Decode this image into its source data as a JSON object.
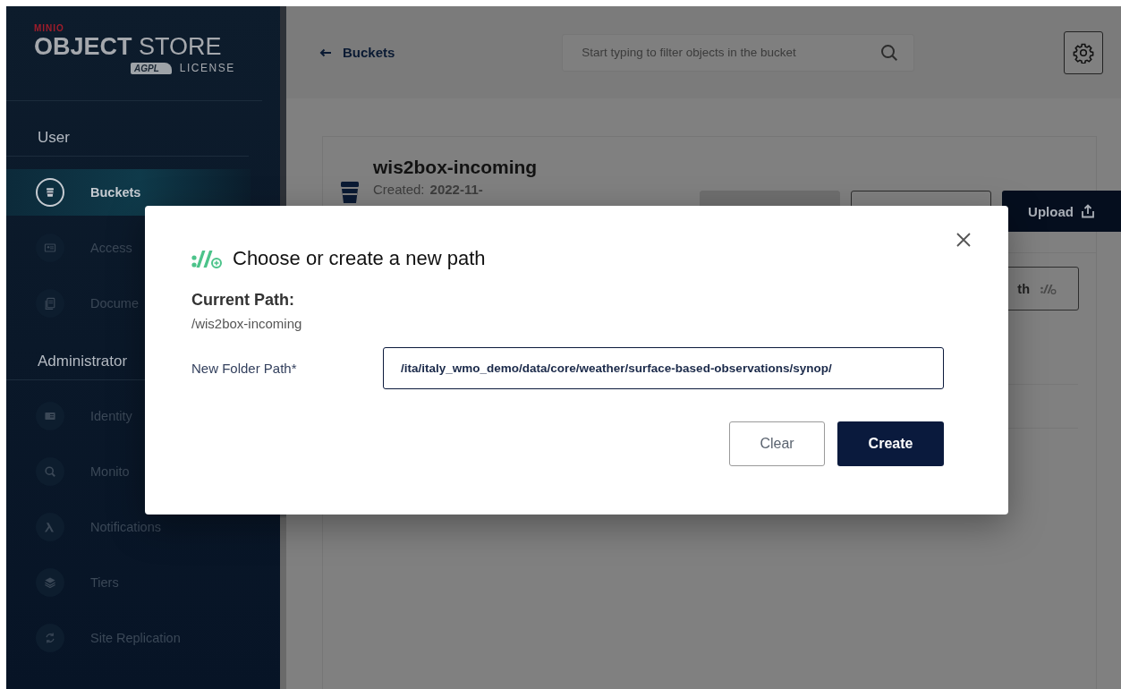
{
  "sidebar": {
    "logo": {
      "brand": "MINIO",
      "product": "**OBJECT** STORE",
      "badge": "AGPL",
      "license": "LICENSE"
    },
    "sections": [
      {
        "title": "User",
        "items": [
          {
            "label": "Buckets",
            "selected": true
          },
          {
            "label": "Access",
            "selected": false
          },
          {
            "label": "Docume",
            "selected": false
          }
        ]
      },
      {
        "title": "Administrator",
        "items": [
          {
            "label": "Identity",
            "selected": false
          },
          {
            "label": "Monito",
            "selected": false
          },
          {
            "label": "Notifications",
            "selected": false
          },
          {
            "label": "Tiers",
            "selected": false
          },
          {
            "label": "Site Replication",
            "selected": false
          }
        ]
      }
    ]
  },
  "header": {
    "back_link": "Buckets",
    "search": {
      "placeholder": "Start typing to filter objects in the bucket"
    }
  },
  "bucket": {
    "name": "wis2box-incoming",
    "created_label": "Created:",
    "created_value": "2022-11-",
    "upload_button": "Upload",
    "path_button": "th"
  },
  "dialog": {
    "title": "Choose or create a new path",
    "current_path_label": "Current Path:",
    "current_path": "/wis2box-incoming",
    "field_label": "New Folder Path*",
    "field_value": "/ita/italy_wmo_demo/data/core/weather/surface-based-observations/synop/",
    "buttons": [
      {
        "label": "Clear",
        "kind": "secondary"
      },
      {
        "label": "Create",
        "kind": "primary"
      }
    ]
  }
}
